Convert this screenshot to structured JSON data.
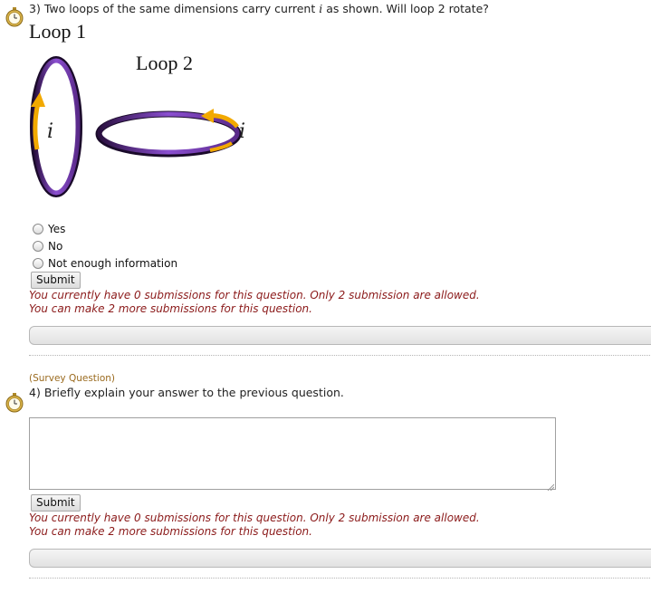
{
  "q3": {
    "number": "3)",
    "text_before": "Two loops of the same dimensions carry current",
    "current_symbol": "i",
    "text_after": "as shown. Will loop 2 rotate?",
    "figure": {
      "loop1_label": "Loop 1",
      "loop2_label": "Loop 2",
      "current_label_1": "i",
      "current_label_2": "i",
      "ring_color": "#7b3fb5",
      "arrow_color": "#f2a900"
    },
    "options": [
      "Yes",
      "No",
      "Not enough information"
    ],
    "submit_label": "Submit",
    "message_line1": "You currently have 0 submissions for this question. Only 2 submission are allowed.",
    "message_line2": "You can make 2 more submissions for this question."
  },
  "q4": {
    "survey_tag": "(Survey Question)",
    "number": "4)",
    "text": "Briefly explain your answer to the previous question.",
    "answer_value": "",
    "submit_label": "Submit",
    "message_line1": "You currently have 0 submissions for this question. Only 2 submission are allowed.",
    "message_line2": "You can make 2 more submissions for this question."
  },
  "icons": {
    "question_icon": "stopwatch-icon"
  },
  "colors": {
    "message": "#8b1a1a",
    "survey_tag": "#9a6a1e"
  }
}
